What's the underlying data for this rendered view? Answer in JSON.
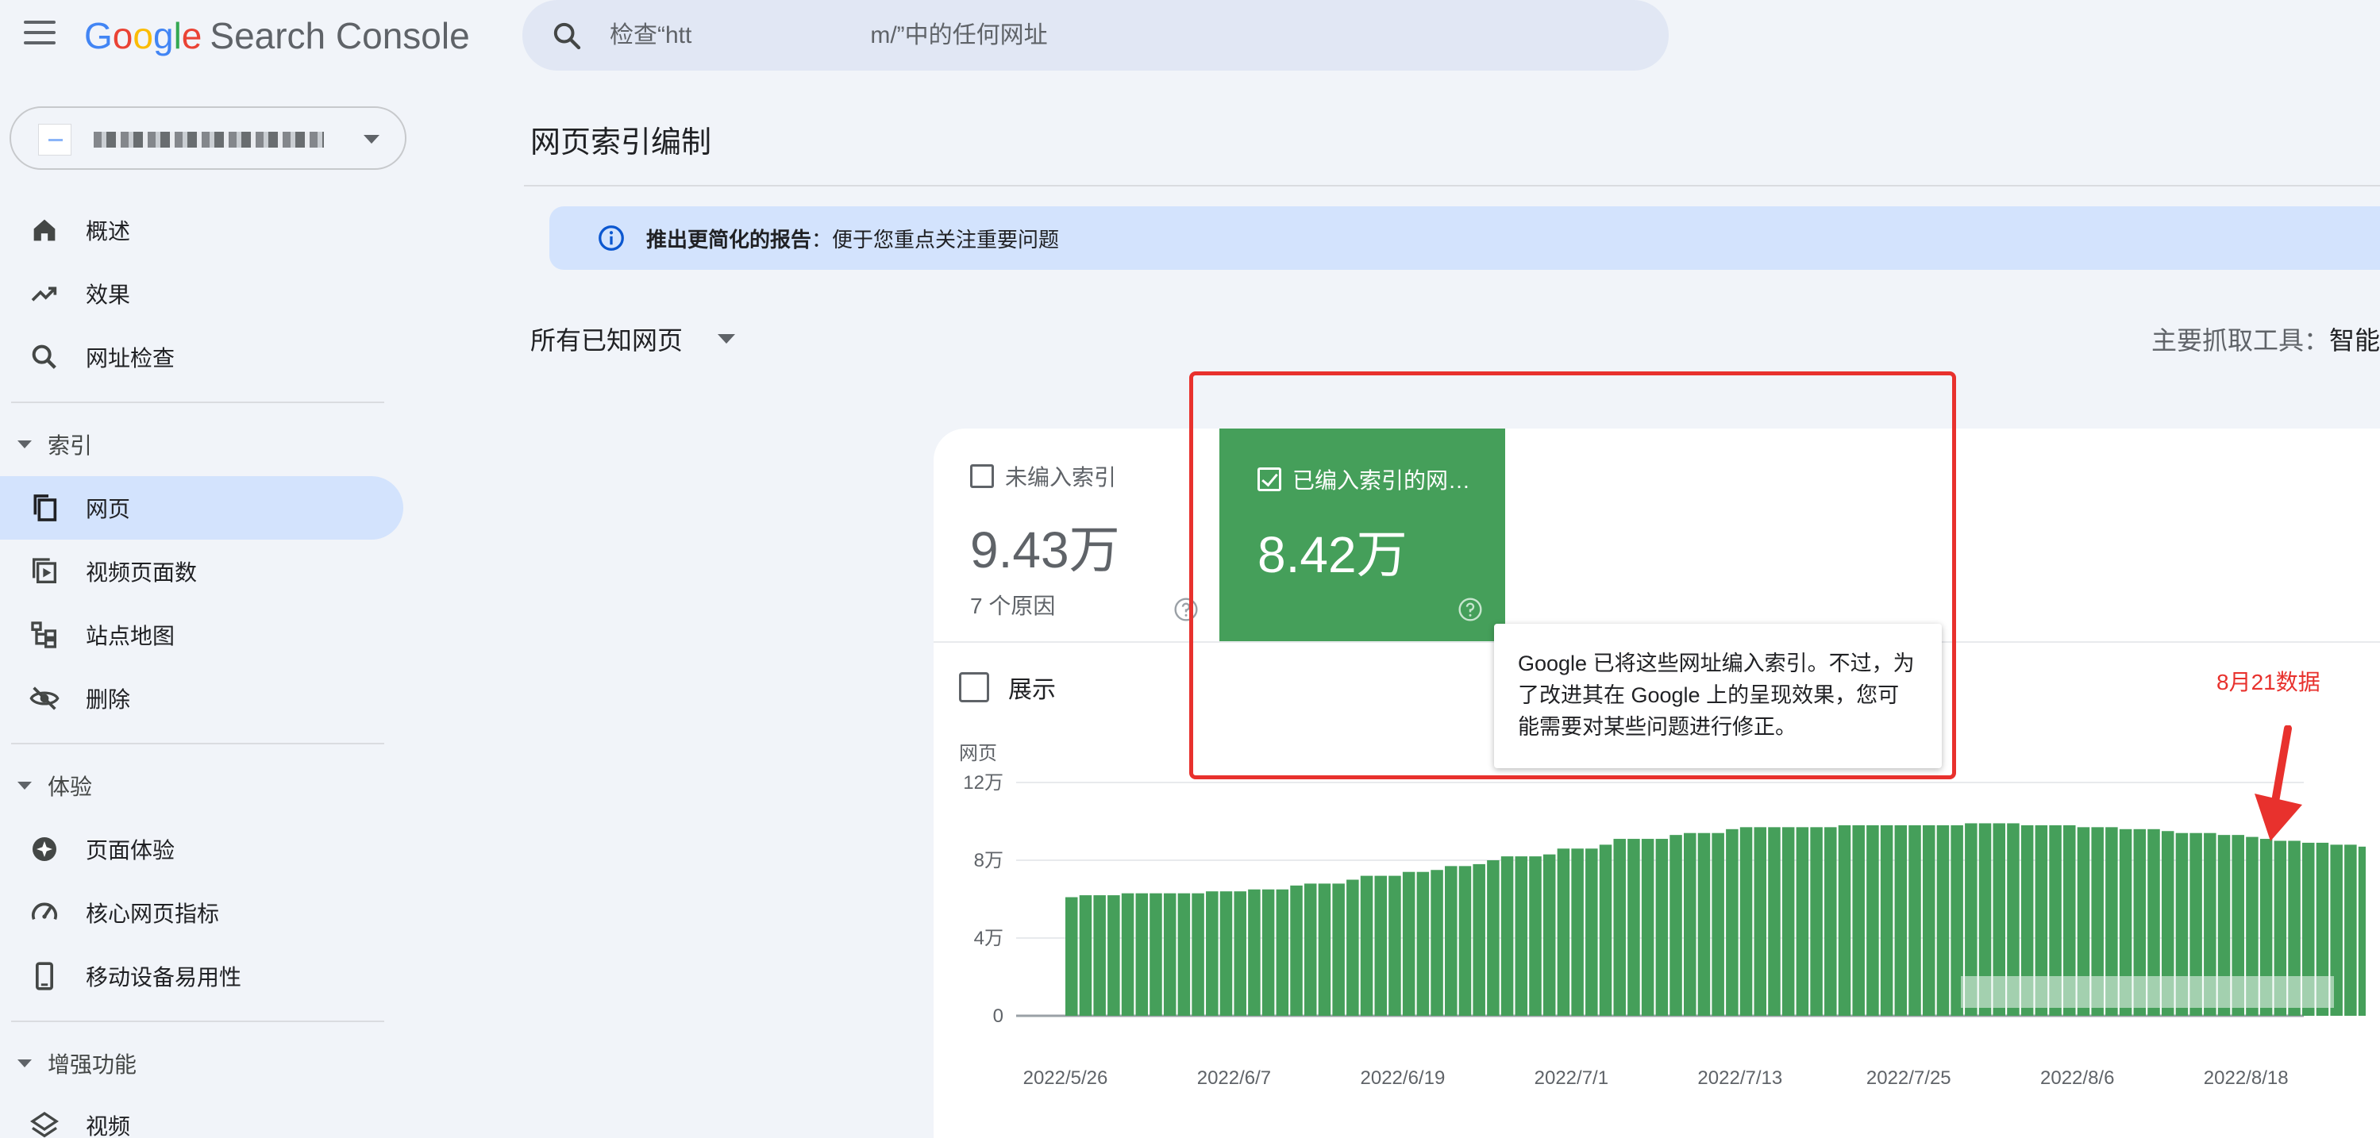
{
  "app": {
    "logo_google_letters": [
      "G",
      "o",
      "o",
      "g",
      "l",
      "e"
    ],
    "logo_google_colors": [
      "#4285f4",
      "#ea4335",
      "#fbbc05",
      "#4285f4",
      "#34a853",
      "#ea4335"
    ],
    "logo_product": "Search Console"
  },
  "search": {
    "placeholder": "检查“htt               m/”中的任何网址"
  },
  "sidebar": {
    "items_top": [
      {
        "label": "概述",
        "icon": "home-icon"
      },
      {
        "label": "效果",
        "icon": "trending-up-icon"
      },
      {
        "label": "网址检查",
        "icon": "search-icon"
      }
    ],
    "section_index": "索引",
    "items_index": [
      {
        "label": "网页",
        "icon": "pages-icon",
        "active": true
      },
      {
        "label": "视频页面数",
        "icon": "video-pages-icon"
      },
      {
        "label": "站点地图",
        "icon": "sitemap-icon"
      },
      {
        "label": "删除",
        "icon": "removals-icon"
      }
    ],
    "section_experience": "体验",
    "items_experience": [
      {
        "label": "页面体验",
        "icon": "page-experience-icon"
      },
      {
        "label": "核心网页指标",
        "icon": "speed-icon"
      },
      {
        "label": "移动设备易用性",
        "icon": "phone-icon"
      }
    ],
    "section_enhancements": "增强功能",
    "items_enhancements": [
      {
        "label": "视频",
        "icon": "layers-icon"
      }
    ]
  },
  "main": {
    "title": "网页索引编制",
    "banner": {
      "strong": "推出更简化的报告",
      "text": "：便于您重点关注重要问题",
      "color": "#d3e3fd"
    },
    "filter": "所有已知网页",
    "crawler_label": "主要抓取工具：",
    "crawler_value": "智能",
    "metrics": {
      "unindexed": {
        "label": "未编入索引",
        "value": "9.43万",
        "sub": "7 个原因",
        "selected": false
      },
      "indexed": {
        "label": "已编入索引的网…",
        "value": "8.42万",
        "selected": true,
        "color": "#459f5a"
      }
    },
    "show_label": "展示",
    "tooltip": "Google 已将这些网址编入索引。不过，为了改进其在 Google 上的呈现效果，您可能需要对某些问题进行修正。",
    "annotation": "8月21数据",
    "annotation_color": "#e8312d"
  },
  "chart_data": {
    "type": "bar",
    "ylabel": "网页",
    "ylim": [
      0,
      120000
    ],
    "yticks": [
      0,
      40000,
      80000,
      120000
    ],
    "ytick_labels": [
      "0",
      "4万",
      "8万",
      "12万"
    ],
    "xtick_labels": [
      "2022/5/26",
      "2022/6/7",
      "2022/6/19",
      "2022/7/1",
      "2022/7/13",
      "2022/7/25",
      "2022/8/6",
      "2022/8/18"
    ],
    "start_date": "2022-05-26",
    "end_date": "2022-08-21",
    "bar_color": "#459f5a",
    "values": [
      61000,
      62000,
      62000,
      62000,
      63000,
      63000,
      63000,
      63000,
      63000,
      63000,
      64000,
      64000,
      64000,
      65000,
      65000,
      65000,
      67000,
      68000,
      68000,
      68000,
      70000,
      72000,
      72000,
      72000,
      74000,
      74000,
      75000,
      77000,
      77000,
      78000,
      80000,
      82000,
      82000,
      82000,
      83000,
      86000,
      86000,
      86000,
      88000,
      91000,
      91000,
      91000,
      91000,
      93000,
      94000,
      94000,
      94000,
      96000,
      97000,
      97000,
      97000,
      97000,
      97000,
      97000,
      97000,
      98000,
      98000,
      98000,
      98000,
      98000,
      98000,
      98000,
      98000,
      98000,
      99000,
      99000,
      99000,
      99000,
      98000,
      98000,
      98000,
      98000,
      97000,
      97000,
      97000,
      96000,
      96000,
      96000,
      95000,
      94000,
      94000,
      94000,
      93000,
      93000,
      92000,
      91000,
      90000,
      90000,
      89000,
      89000,
      88000,
      88000,
      87000,
      87000,
      87000,
      86000,
      86000,
      85000,
      85000,
      84000,
      84200,
      84200
    ]
  }
}
